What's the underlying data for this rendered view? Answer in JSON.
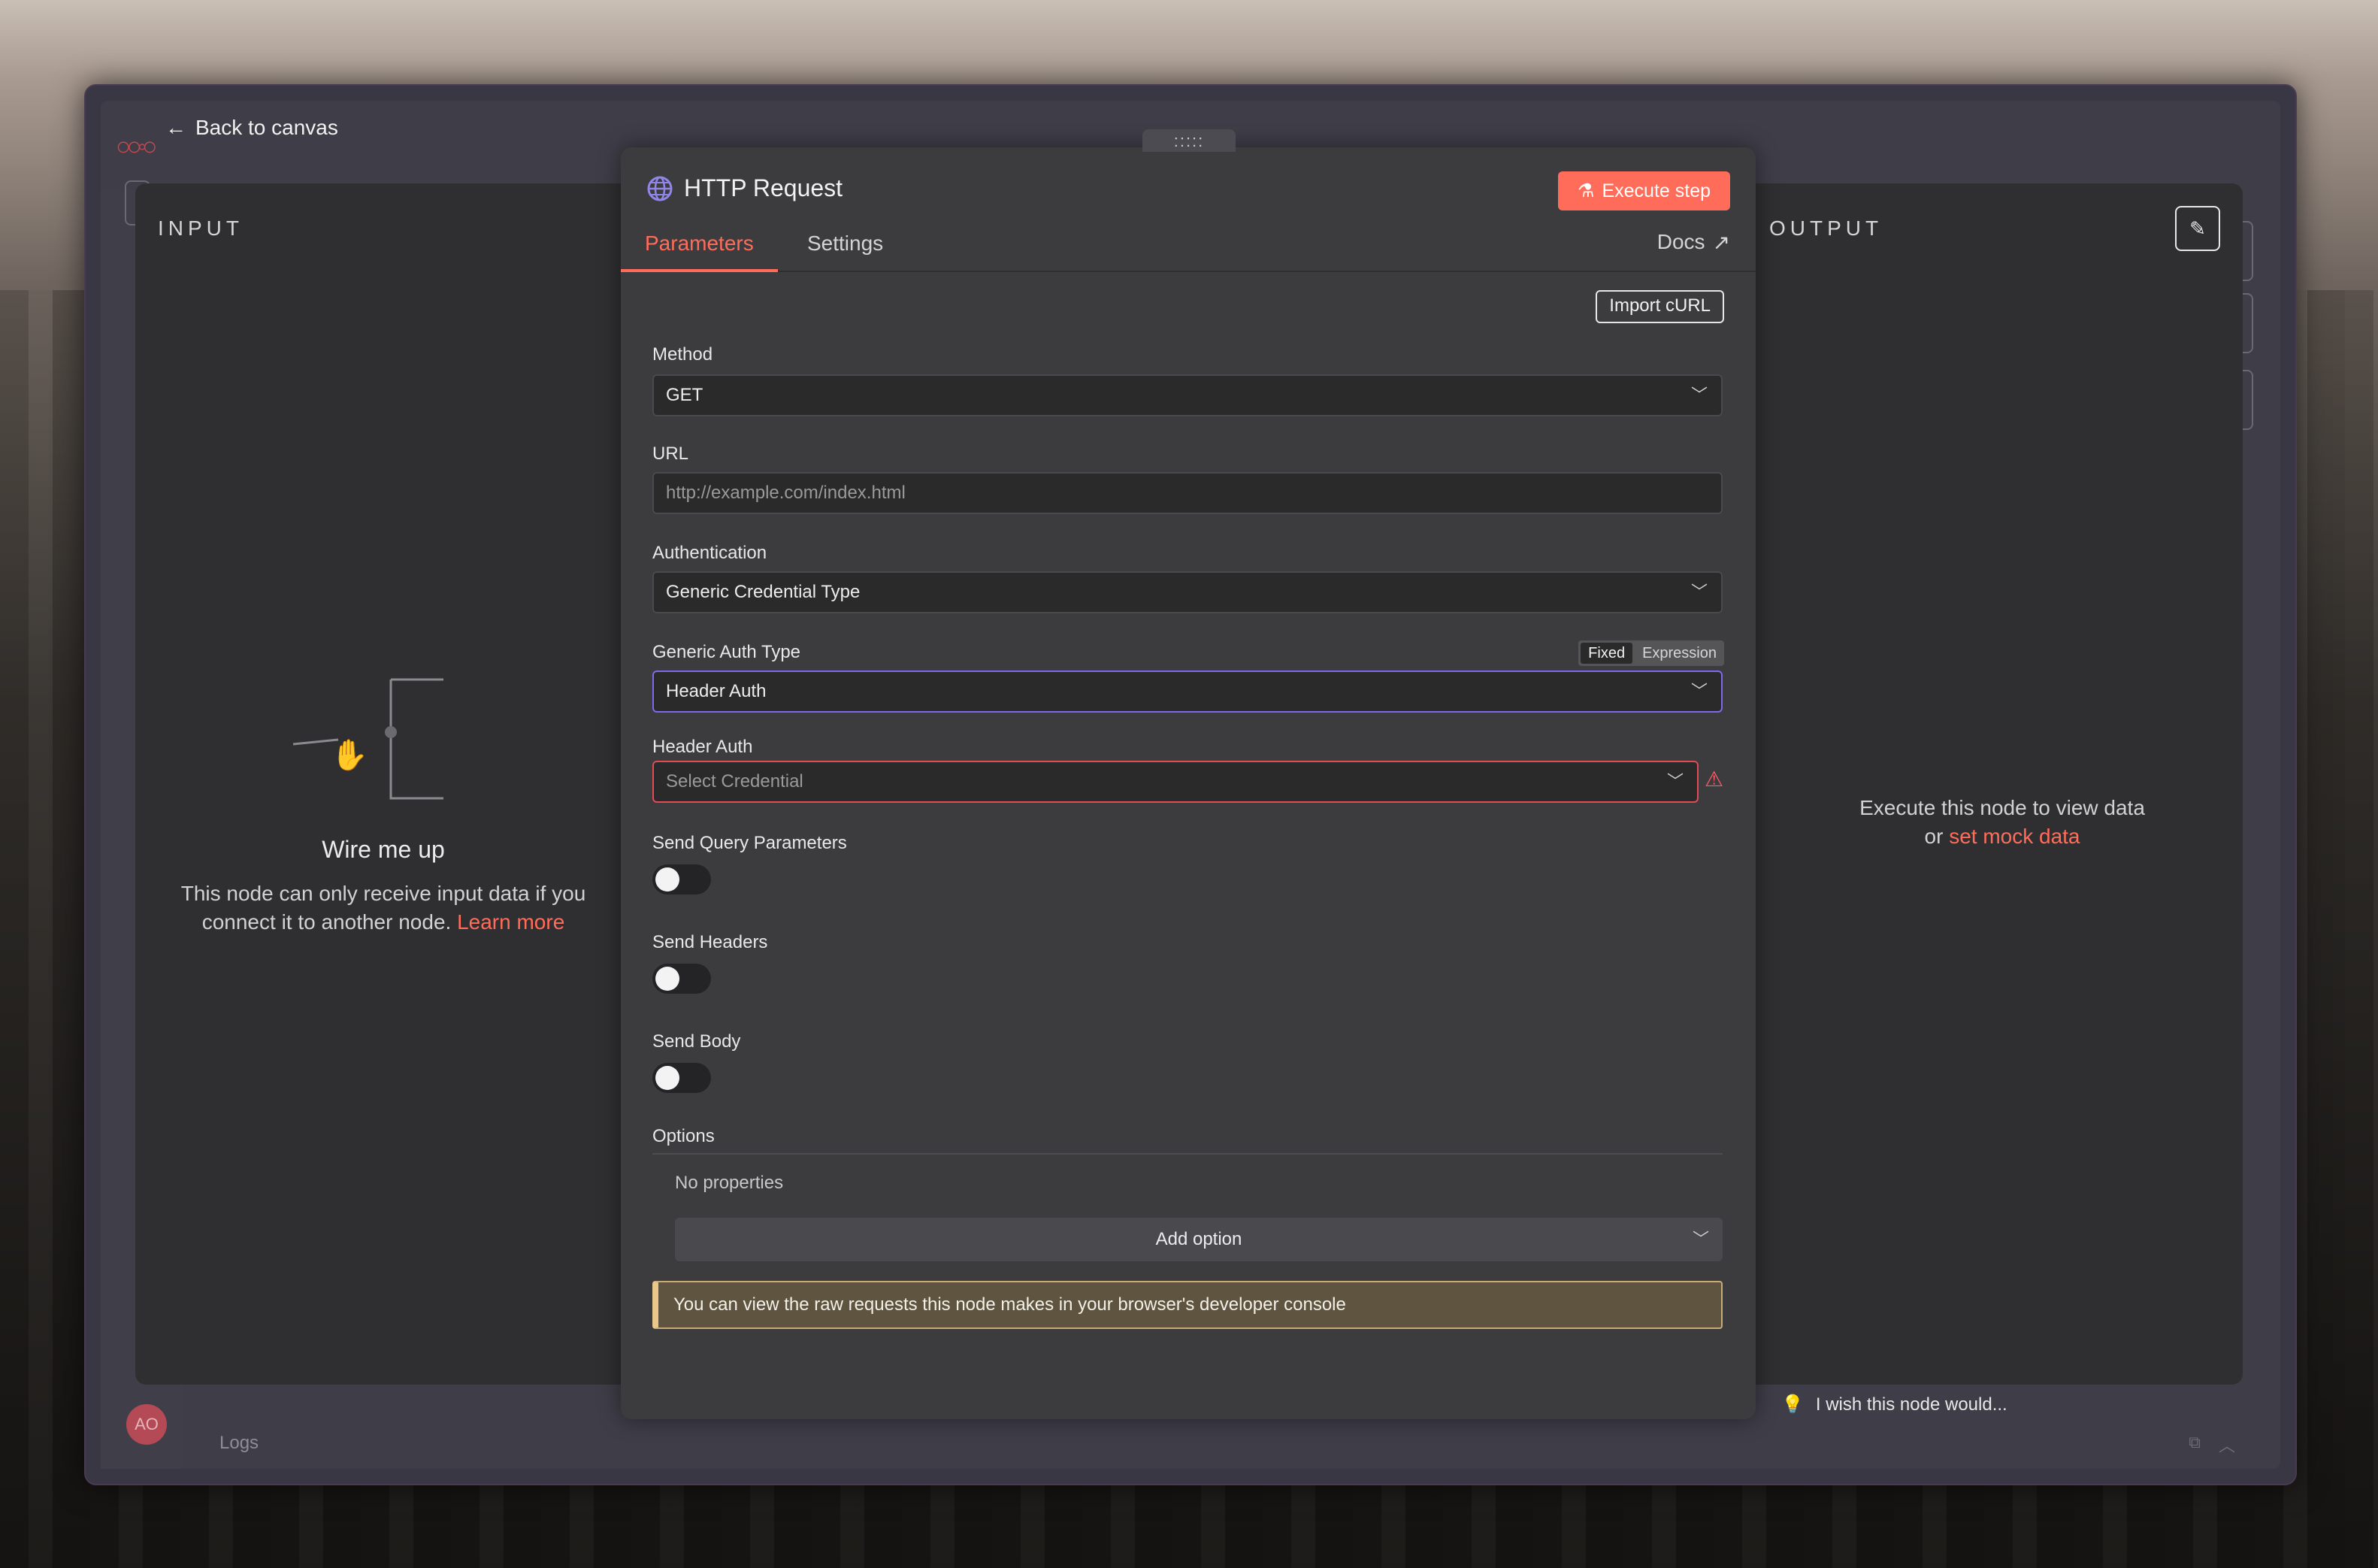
{
  "header": {
    "back_label": "Back to canvas",
    "drag_handle": ":::::"
  },
  "input_panel": {
    "label": "INPUT",
    "empty_title": "Wire me up",
    "empty_desc": "This node can only receive input data if you connect it to another node.",
    "learn_more": "Learn more"
  },
  "output_panel": {
    "label": "OUTPUT",
    "empty_line1": "Execute this node to view data",
    "empty_or": "or",
    "mock_link": "set mock data"
  },
  "node": {
    "title": "HTTP Request",
    "execute_label": "Execute step",
    "tabs": [
      {
        "label": "Parameters",
        "active": true
      },
      {
        "label": "Settings",
        "active": false
      }
    ],
    "docs_label": "Docs",
    "import_curl": "Import cURL",
    "fields": {
      "method": {
        "label": "Method",
        "value": "GET"
      },
      "url": {
        "label": "URL",
        "placeholder": "http://example.com/index.html"
      },
      "authentication": {
        "label": "Authentication",
        "value": "Generic Credential Type"
      },
      "generic_auth_type": {
        "label": "Generic Auth Type",
        "value": "Header Auth",
        "mode_fixed": "Fixed",
        "mode_expression": "Expression"
      },
      "header_auth": {
        "label": "Header Auth",
        "placeholder": "Select Credential"
      },
      "send_query": {
        "label": "Send Query Parameters",
        "enabled": false
      },
      "send_headers": {
        "label": "Send Headers",
        "enabled": false
      },
      "send_body": {
        "label": "Send Body",
        "enabled": false
      }
    },
    "options": {
      "label": "Options",
      "empty": "No properties",
      "add_label": "Add option"
    },
    "notice": "You can view the raw requests this node makes in your browser's developer console"
  },
  "footer": {
    "feedback": "I wish this node would...",
    "logs_label": "Logs",
    "avatar_initials": "AO"
  },
  "colors": {
    "accent": "#ff6d5a",
    "focus": "#7c6be8",
    "error": "#e04b57",
    "notice_border": "#e9c889"
  }
}
